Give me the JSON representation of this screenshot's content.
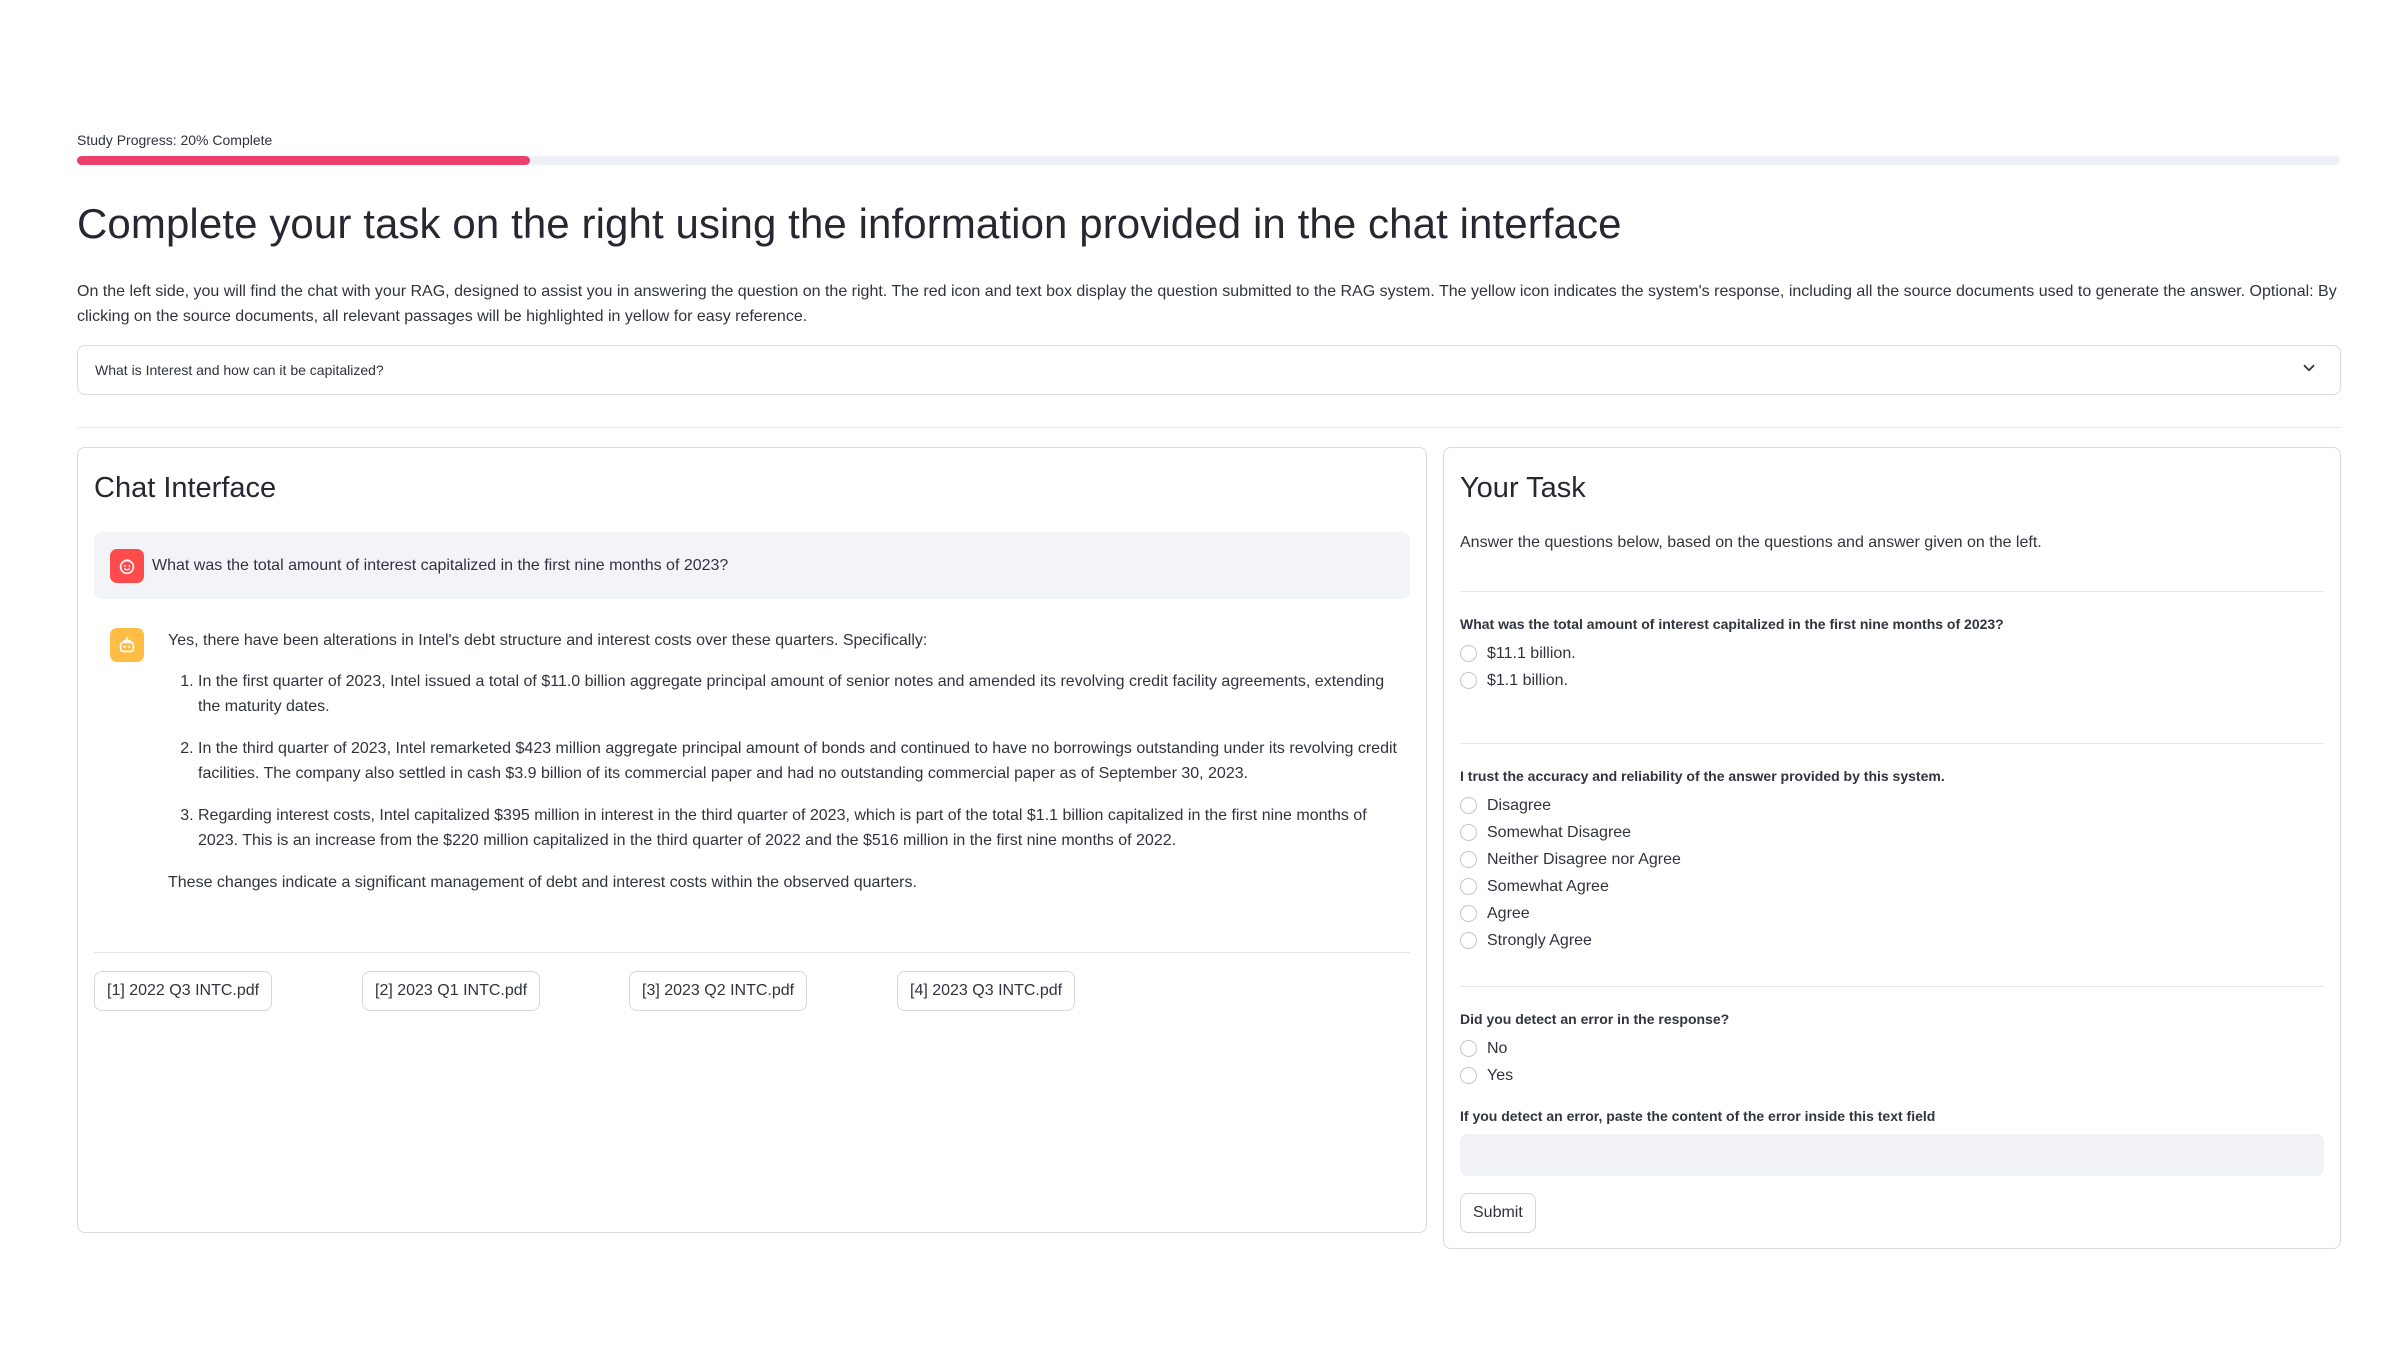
{
  "progress": {
    "label": "Study Progress: 20% Complete",
    "fraction": 0.2,
    "color": "#ec3f6b"
  },
  "page_title": "Complete your task on the right using the information provided in the chat interface",
  "intro": "On the left side, you will find the chat with your RAG, designed to assist you in answering the question on the right. The red icon and text box display the question submitted to the RAG system. The yellow icon indicates the system's response, including all the source documents used to generate the answer. Optional: By clicking on the source documents, all relevant passages will be highlighted in yellow for easy reference.",
  "expander": {
    "label": "What is Interest and how can it be capitalized?",
    "icon": "chevron-down-icon"
  },
  "chat": {
    "title": "Chat Interface",
    "user_message": "What was the total amount of interest capitalized in the first nine months of 2023?",
    "user_icon": "user-face-icon",
    "user_icon_color": "#ff4b4b",
    "bot_icon": "robot-icon",
    "bot_icon_color": "#ffbd45",
    "bot_intro": "Yes, there have been alterations in Intel's debt structure and interest costs over these quarters. Specifically:",
    "bot_points": [
      "In the first quarter of 2023, Intel issued a total of $11.0 billion aggregate principal amount of senior notes and amended its revolving credit facility agreements, extending the maturity dates.",
      "In the third quarter of 2023, Intel remarketed $423 million aggregate principal amount of bonds and continued to have no borrowings outstanding under its revolving credit facilities. The company also settled in cash $3.9 billion of its commercial paper and had no outstanding commercial paper as of September 30, 2023.",
      "Regarding interest costs, Intel capitalized $395 million in interest in the third quarter of 2023, which is part of the total $1.1 billion capitalized in the first nine months of 2023. This is an increase from the $220 million capitalized in the third quarter of 2022 and the $516 million in the first nine months of 2022."
    ],
    "bot_conclusion": "These changes indicate a significant management of debt and interest costs within the observed quarters.",
    "sources": [
      "[1] 2022 Q3 INTC.pdf",
      "[2] 2023 Q1 INTC.pdf",
      "[3] 2023 Q2 INTC.pdf",
      "[4] 2023 Q3 INTC.pdf"
    ]
  },
  "task": {
    "title": "Your Task",
    "intro": "Answer the questions below, based on the questions and answer given on the left.",
    "q1": {
      "label": "What was the total amount of interest capitalized in the first nine months of 2023?",
      "options": [
        "$11.1 billion.",
        "$1.1 billion."
      ]
    },
    "q2": {
      "label": "I trust the accuracy and reliability of the answer provided by this system.",
      "options": [
        "Disagree",
        "Somewhat Disagree",
        "Neither Disagree nor Agree",
        "Somewhat Agree",
        "Agree",
        "Strongly Agree"
      ]
    },
    "q3": {
      "label": "Did you detect an error in the response?",
      "options": [
        "No",
        "Yes"
      ]
    },
    "error_field_label": "If you detect an error, paste the content of the error inside this text field",
    "error_field_value": "",
    "submit_label": "Submit"
  }
}
